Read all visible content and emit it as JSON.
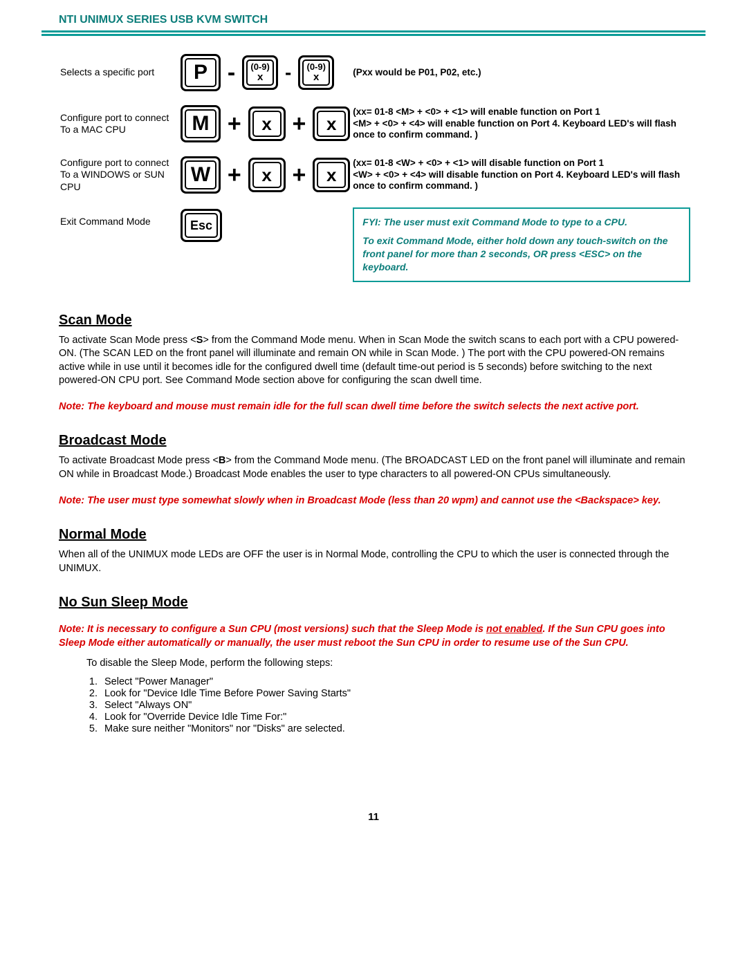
{
  "header": {
    "title": "NTI UNIMUX SERIES USB KVM SWITCH"
  },
  "commands": {
    "row1": {
      "desc": "Selects a specific port",
      "key1": "P",
      "key2_top": "(0-9)",
      "key2_bot": "x",
      "key3_top": "(0-9)",
      "key3_bot": "x",
      "note": "(Pxx would be P01, P02, etc.)"
    },
    "row2": {
      "desc": "Configure port to connect To a MAC CPU",
      "key1": "M",
      "key2": "x",
      "key3": "x",
      "note": "(xx= 01-8  <M> + <0> + <1> will enable function on Port 1\n<M> + <0> + <4> will enable function on Port 4.   Keyboard LED's will flash once to confirm command. )"
    },
    "row3": {
      "desc": "Configure port to connect To a WINDOWS or SUN CPU",
      "key1": "W",
      "key2": "x",
      "key3": "x",
      "note": "(xx= 01-8  <W> + <0> + <1> will disable function on Port 1\n<W> + <0> + <4> will disable function on Port 4.   Keyboard LED's will flash once to confirm command. )"
    },
    "row4": {
      "desc": "Exit Command Mode",
      "key1": "Esc",
      "fyi_line1": "FYI:  The user must exit Command Mode to type to a CPU.",
      "fyi_line2": "To exit Command Mode, either hold down any touch-switch on the front panel for more than 2 seconds, OR  press <ESC> on the keyboard."
    }
  },
  "sections": {
    "scan": {
      "title": "Scan Mode",
      "p1_a": "To activate Scan Mode press <",
      "p1_s": "S",
      "p1_b": "> from the Command Mode menu.  When in Scan Mode the switch scans to each port with a CPU powered-ON. (The SCAN LED on the front panel will illuminate and remain ON while in Scan Mode. ) The port with the CPU powered-ON remains active while in use until it becomes idle for the configured dwell time (default time-out period is 5 seconds) before switching to the next powered-ON CPU port. See Command Mode section above for configuring the scan dwell time.",
      "note": "Note: The keyboard and mouse must remain idle for the full scan dwell time before the switch selects the next active port."
    },
    "broadcast": {
      "title": "Broadcast Mode",
      "p1_a": "To activate Broadcast Mode press <",
      "p1_s": "B",
      "p1_b": "> from the Command Mode menu.  (The BROADCAST LED on the front panel will illuminate and remain ON while in Broadcast Mode.)  Broadcast Mode enables the user to type characters to all powered-ON CPUs simultaneously.",
      "note": "Note:  The user must type somewhat slowly when in Broadcast Mode (less than 20 wpm) and cannot use the <Backspace> key."
    },
    "normal": {
      "title": "Normal Mode",
      "p1": "When all of the UNIMUX mode LEDs are OFF the user is in Normal Mode, controlling the CPU to which the user is connected through the UNIMUX."
    },
    "nosun": {
      "title": "No Sun Sleep Mode",
      "note_a": "Note:  It is necessary to configure a Sun CPU (most versions) such that the Sleep Mode is ",
      "note_und": "not enabled",
      "note_b": ".  If the Sun CPU goes into Sleep Mode either automatically or manually, the user must reboot the Sun CPU in order to resume use of the Sun CPU.",
      "steps_intro": "To disable the Sleep Mode, perform the following steps:",
      "steps": [
        "Select \"Power Manager\"",
        "Look for \"Device Idle Time Before Power Saving Starts\"",
        "Select \"Always ON\"",
        "Look for \"Override Device Idle Time For:\"",
        "Make sure neither \"Monitors\" nor \"Disks\" are selected."
      ]
    }
  },
  "page_number": "11"
}
